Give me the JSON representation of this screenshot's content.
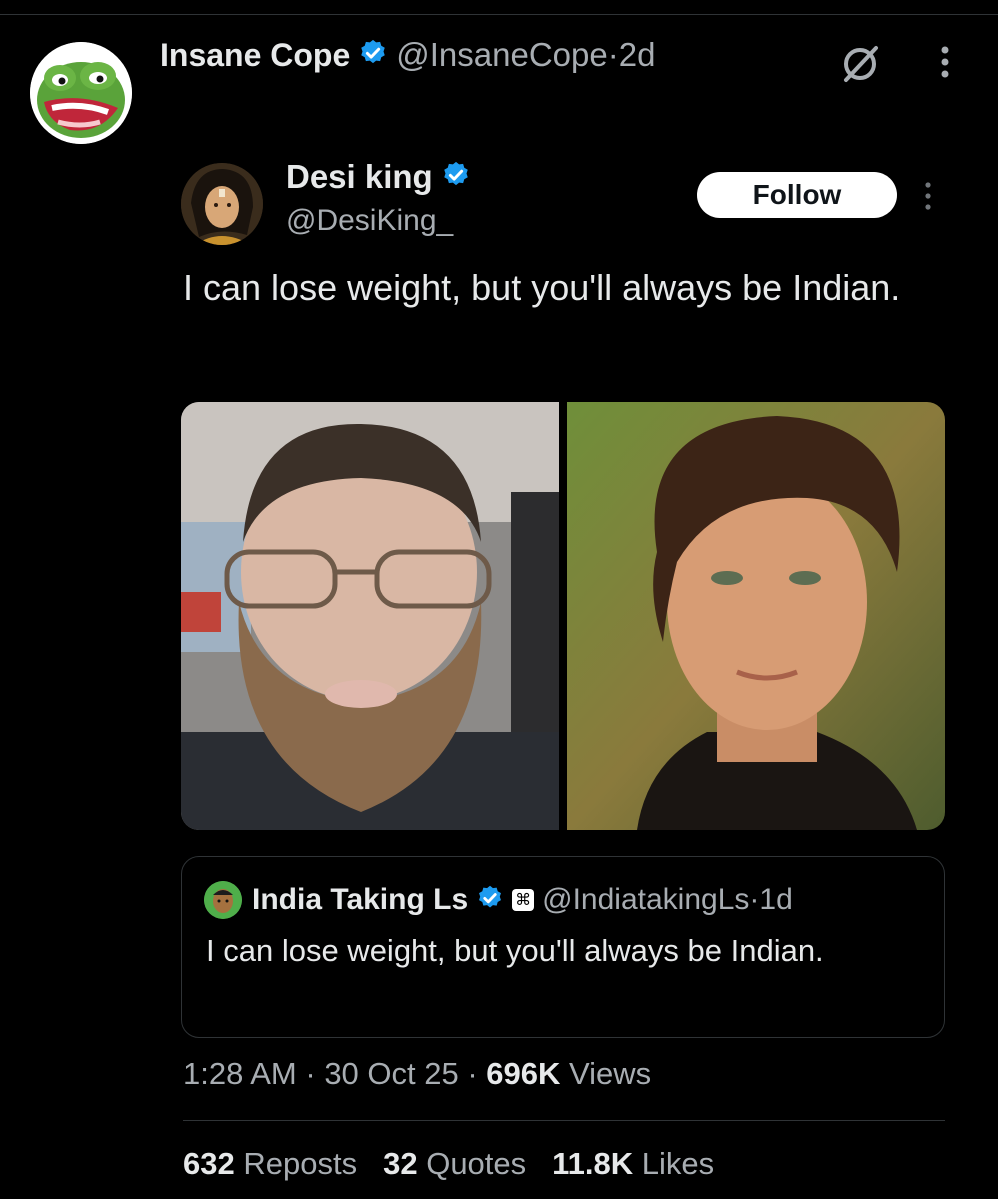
{
  "post": {
    "author_name": "Insane Cope",
    "author_handle": "@InsaneCope",
    "separator": " · ",
    "age": "2d"
  },
  "quoted": {
    "author_name": "Desi king",
    "author_handle": "@DesiKing_",
    "follow_label": "Follow",
    "text": "I can lose weight, but you'll always be Indian."
  },
  "nested_quote": {
    "author_name": "India Taking Ls",
    "author_handle": "@IndiatakingLs",
    "separator": " · ",
    "age": "1d",
    "badge_glyph": "⌘",
    "text": "I can lose weight, but you'll always be Indian."
  },
  "meta": {
    "time": "1:28 AM",
    "separator": " · ",
    "date": "30 Oct 25",
    "views_count": "696K",
    "views_label": "Views"
  },
  "stats": {
    "reposts_count": "632",
    "reposts_label": "Reposts",
    "quotes_count": "32",
    "quotes_label": "Quotes",
    "likes_count": "11.8K",
    "likes_label": "Likes"
  },
  "icons": {
    "verified": "verified-badge-icon",
    "grok": "grok-icon",
    "more": "more-options-icon"
  },
  "colors": {
    "background": "#000000",
    "text_primary": "#e7e9ea",
    "text_secondary": "#a8adb2",
    "verified_blue": "#1d9bf0",
    "divider": "#2f3336"
  }
}
